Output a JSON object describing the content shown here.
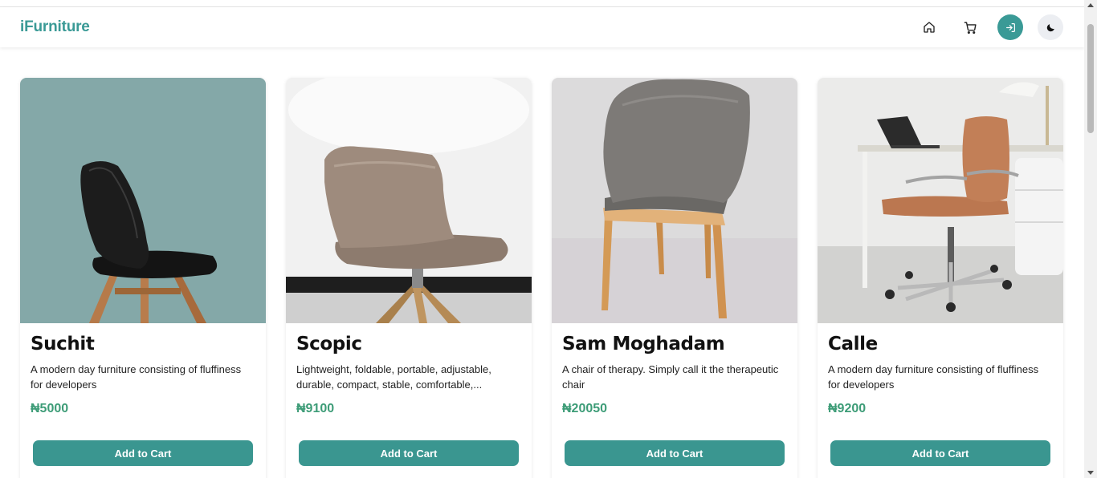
{
  "app": {
    "brand": "iFurniture"
  },
  "nav": {
    "icons": [
      "home-icon",
      "cart-icon",
      "login-icon",
      "moon-icon"
    ],
    "accent": "#3a9a96"
  },
  "products": [
    {
      "name": "Suchit",
      "description": "A modern day furniture consisting of fluffiness for developers",
      "price": "₦5000",
      "button": "Add to Cart"
    },
    {
      "name": "Scopic",
      "description": "Lightweight, foldable, portable, adjustable, durable, compact, stable, comfortable,...",
      "price": "₦9100",
      "button": "Add to Cart"
    },
    {
      "name": "Sam Moghadam",
      "description": "A chair of therapy. Simply call it the therapeutic chair",
      "price": "₦20050",
      "button": "Add to Cart"
    },
    {
      "name": "Calle",
      "description": "A modern day furniture consisting of fluffiness for developers",
      "price": "₦9200",
      "button": "Add to Cart"
    }
  ],
  "colors": {
    "price": "#3d9c77",
    "button": "#3a9690"
  }
}
